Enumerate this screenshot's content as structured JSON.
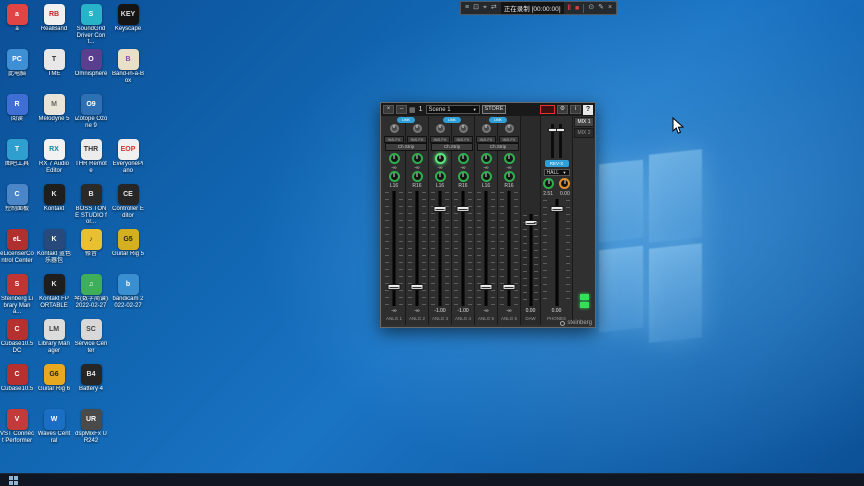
{
  "desktop_icons": [
    {
      "col": 0,
      "row": 0,
      "label": "a",
      "color": "#e04444",
      "glyph": "a",
      "glyph_color": "#ffffff"
    },
    {
      "col": 0,
      "row": 1,
      "label": "此电脑",
      "color": "#3f8fd4",
      "glyph": "PC",
      "glyph_color": "#ffffff"
    },
    {
      "col": 0,
      "row": 2,
      "label": "阅读",
      "color": "#3f6fd4",
      "glyph": "R",
      "glyph_color": "#ffffff"
    },
    {
      "col": 0,
      "row": 3,
      "label": "图吧工具",
      "color": "#2f9fd0",
      "glyph": "T",
      "glyph_color": "#ffffff"
    },
    {
      "col": 0,
      "row": 4,
      "label": "控制面板",
      "color": "#4a86c8",
      "glyph": "C",
      "glyph_color": "#ffffff"
    },
    {
      "col": 0,
      "row": 5,
      "label": "eLicenserControl Center",
      "color": "#b03030",
      "glyph": "eL",
      "glyph_color": "#ffffff"
    },
    {
      "col": 0,
      "row": 6,
      "label": "Steinberg Library Mana...",
      "color": "#c03434",
      "glyph": "S",
      "glyph_color": "#ffffff"
    },
    {
      "col": 0,
      "row": 7,
      "label": "Cubase10.5 DC",
      "color": "#b5302e",
      "glyph": "C",
      "glyph_color": "#ffffff"
    },
    {
      "col": 0,
      "row": 8,
      "label": "Cubase10.5",
      "color": "#b5302e",
      "glyph": "C",
      "glyph_color": "#ffffff"
    },
    {
      "col": 0,
      "row": 9,
      "label": "VST Connect Performer",
      "color": "#c23a3a",
      "glyph": "V",
      "glyph_color": "#ffffff"
    },
    {
      "col": 1,
      "row": 0,
      "label": "RealBand",
      "color": "#f0f0f0",
      "glyph": "RB",
      "glyph_color": "#c22222"
    },
    {
      "col": 1,
      "row": 1,
      "label": "TME",
      "color": "#e8e8e8",
      "glyph": "T",
      "glyph_color": "#333333"
    },
    {
      "col": 1,
      "row": 2,
      "label": "Melodyne 5",
      "color": "#e9e4d8",
      "glyph": "M",
      "glyph_color": "#666666"
    },
    {
      "col": 1,
      "row": 3,
      "label": "RX 7 Audio Editor",
      "color": "#f2f2f2",
      "glyph": "RX",
      "glyph_color": "#0a8aa0"
    },
    {
      "col": 1,
      "row": 4,
      "label": "Kontakt",
      "color": "#1e1e1e",
      "glyph": "K",
      "glyph_color": "#e8e8e8"
    },
    {
      "col": 1,
      "row": 5,
      "label": "Kontakt 蓝色乐器包",
      "color": "#28497c",
      "glyph": "K",
      "glyph_color": "#ffffff"
    },
    {
      "col": 1,
      "row": 6,
      "label": "Kontakt FP ORTABLE",
      "color": "#1e1e1e",
      "glyph": "K",
      "glyph_color": "#e8e8e8"
    },
    {
      "col": 1,
      "row": 7,
      "label": "Library Manager",
      "color": "#dcdcdc",
      "glyph": "LM",
      "glyph_color": "#444444"
    },
    {
      "col": 1,
      "row": 8,
      "label": "Guitar Rig 6",
      "color": "#e8a820",
      "glyph": "G6",
      "glyph_color": "#222222"
    },
    {
      "col": 1,
      "row": 9,
      "label": "Waves Central",
      "color": "#1a6fc4",
      "glyph": "W",
      "glyph_color": "#ffffff"
    },
    {
      "col": 2,
      "row": 0,
      "label": "SoundGrid Driver Cont...",
      "color": "#28b4c8",
      "glyph": "S",
      "glyph_color": "#ffffff"
    },
    {
      "col": 2,
      "row": 1,
      "label": "Omnisphere",
      "color": "#5a3f8f",
      "glyph": "O",
      "glyph_color": "#ffffff"
    },
    {
      "col": 2,
      "row": 2,
      "label": "iZotope Ozone 9",
      "color": "#2f6fb4",
      "glyph": "O9",
      "glyph_color": "#ffffff"
    },
    {
      "col": 2,
      "row": 3,
      "label": "THR Remote",
      "color": "#ececec",
      "glyph": "THR",
      "glyph_color": "#333333"
    },
    {
      "col": 2,
      "row": 4,
      "label": "BOSS TONE STUDIO for...",
      "color": "#2a2a2a",
      "glyph": "B",
      "glyph_color": "#eeeeee"
    },
    {
      "col": 2,
      "row": 5,
      "label": "修音",
      "color": "#e8c030",
      "glyph": "♪",
      "glyph_color": "#333333"
    },
    {
      "col": 2,
      "row": 6,
      "label": "琴(数字简谱) 2022-02-27",
      "color": "#3fae5a",
      "glyph": "♫",
      "glyph_color": "#ffffff"
    },
    {
      "col": 2,
      "row": 7,
      "label": "Service Center",
      "color": "#d8d8d8",
      "glyph": "SC",
      "glyph_color": "#444444"
    },
    {
      "col": 2,
      "row": 8,
      "label": "Battery 4",
      "color": "#262626",
      "glyph": "B4",
      "glyph_color": "#e8e8e8"
    },
    {
      "col": 2,
      "row": 9,
      "label": "dspMixFx UR242",
      "color": "#4a4a4a",
      "glyph": "UR",
      "glyph_color": "#ffffff"
    },
    {
      "col": 3,
      "row": 0,
      "label": "Keyscape",
      "color": "#141414",
      "glyph": "KEY",
      "glyph_color": "#dddddd"
    },
    {
      "col": 3,
      "row": 1,
      "label": "Band-in-a-Box",
      "color": "#e8e0c8",
      "glyph": "B",
      "glyph_color": "#8a4aa0"
    },
    {
      "col": 3,
      "row": 3,
      "label": "EveryonePiano",
      "color": "#f0f0f0",
      "glyph": "EOP",
      "glyph_color": "#d33333"
    },
    {
      "col": 3,
      "row": 4,
      "label": "Controller Editor",
      "color": "#262626",
      "glyph": "CE",
      "glyph_color": "#e8e8e8"
    },
    {
      "col": 3,
      "row": 5,
      "label": "Guitar Rig 5",
      "color": "#d4b020",
      "glyph": "G5",
      "glyph_color": "#222222"
    },
    {
      "col": 3,
      "row": 6,
      "label": "bandicam 2022-02-27",
      "color": "#3a8fd0",
      "glyph": "b",
      "glyph_color": "#ffffff"
    }
  ],
  "recording_bar": {
    "menu_icon": "≡",
    "screen_icon": "⊡",
    "target_icon": "⌖",
    "arrows_icon": "⇄",
    "status": "正在录制 [00:00:00]",
    "pause_icon": "‖",
    "stop_icon": "■",
    "camera_icon": "⊙",
    "draw_icon": "✎",
    "close_icon": "×"
  },
  "mixer": {
    "titlebar": {
      "close": "×",
      "minimize": "–",
      "grid_icon": "▦",
      "scene_number": "1",
      "scene_name": "Scene 1",
      "dropdown_arrow": "▼",
      "store": "STORE",
      "gear_icon": "⚙",
      "info_icon": "i",
      "help": "?"
    },
    "tabs": [
      {
        "label": "MIX 1",
        "active": true
      },
      {
        "label": "MIX 2",
        "active": false
      }
    ],
    "pairs": [
      {
        "link": "LINK",
        "ch_strip": "Ch.Strip"
      },
      {
        "link": "LINK",
        "ch_strip": "Ch.Strip"
      },
      {
        "link": "LINK",
        "ch_strip": "Ch.Strip"
      }
    ],
    "channels": [
      {
        "ins_fx": "INS.FX",
        "send": "-∞",
        "pan": "L16",
        "value": "-∞",
        "name": "ANLG 1",
        "fader_pct": 80
      },
      {
        "ins_fx": "INS.FX",
        "send": "-∞",
        "pan": "R16",
        "value": "-∞",
        "name": "ANLG 2",
        "fader_pct": 80
      },
      {
        "ins_fx": "INS.FX",
        "send": "-∞",
        "pan": "L16",
        "value": "-1.00",
        "name": "ANLG 3",
        "fader_pct": 14,
        "send_on": true
      },
      {
        "ins_fx": "INS.FX",
        "send": "-∞",
        "pan": "R16",
        "value": "-1.00",
        "name": "ANLG 4",
        "fader_pct": 14
      },
      {
        "ins_fx": "INS.FX",
        "send": "-∞",
        "pan": "L16",
        "value": "-∞",
        "name": "ANLG 5",
        "fader_pct": 80
      },
      {
        "ins_fx": "INS.FX",
        "send": "-∞",
        "pan": "R16",
        "value": "-∞",
        "name": "ANLG 6",
        "fader_pct": 80
      }
    ],
    "daw": {
      "value": "0.00",
      "name": "DAW",
      "fader_pct": 8
    },
    "master": {
      "rev_x": "REV-X",
      "reverb_type": "HALL",
      "dropdown_arrow": "▼",
      "time_value": "2.51",
      "return_value": "0.00",
      "value": "0.00",
      "name": "PHONES",
      "fader_pct": 8
    },
    "brand": "steinberg"
  }
}
